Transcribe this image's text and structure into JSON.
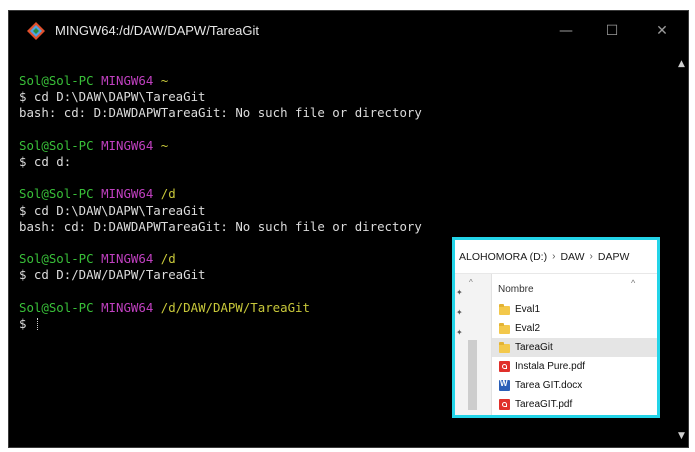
{
  "window": {
    "title": "MINGW64:/d/DAW/DAPW/TareaGit",
    "minimize_glyph": "—",
    "maximize_glyph": "☐",
    "close_glyph": "✕",
    "app_icon": "git-bash-icon"
  },
  "terminal": {
    "lines": [
      {
        "kind": "prompt",
        "user": "Sol@Sol-PC",
        "env": "MINGW64",
        "path": "~"
      },
      {
        "kind": "cmd",
        "text": "$ cd D:\\DAW\\DAPW\\TareaGit"
      },
      {
        "kind": "out",
        "text": "bash: cd: D:DAWDAPWTareaGit: No such file or directory"
      },
      {
        "kind": "blank"
      },
      {
        "kind": "prompt",
        "user": "Sol@Sol-PC",
        "env": "MINGW64",
        "path": "~"
      },
      {
        "kind": "cmd",
        "text": "$ cd d:"
      },
      {
        "kind": "blank"
      },
      {
        "kind": "prompt",
        "user": "Sol@Sol-PC",
        "env": "MINGW64",
        "path": "/d"
      },
      {
        "kind": "cmd",
        "text": "$ cd D:\\DAW\\DAPW\\TareaGit"
      },
      {
        "kind": "out",
        "text": "bash: cd: D:DAWDAPWTareaGit: No such file or directory"
      },
      {
        "kind": "blank"
      },
      {
        "kind": "prompt",
        "user": "Sol@Sol-PC",
        "env": "MINGW64",
        "path": "/d"
      },
      {
        "kind": "cmd",
        "text": "$ cd D:/DAW/DAPW/TareaGit"
      },
      {
        "kind": "blank"
      },
      {
        "kind": "prompt",
        "user": "Sol@Sol-PC",
        "env": "MINGW64",
        "path": "/d/DAW/DAPW/TareaGit"
      },
      {
        "kind": "input",
        "text": "$ "
      }
    ]
  },
  "explorer": {
    "breadcrumb": [
      "ALOHOMORA (D:)",
      "DAW",
      "DAPW"
    ],
    "breadcrumb_sep": "›",
    "column_header": "Nombre",
    "files": [
      {
        "name": "Eval1",
        "type": "folder",
        "selected": false
      },
      {
        "name": "Eval2",
        "type": "folder",
        "selected": false
      },
      {
        "name": "TareaGit",
        "type": "folder",
        "selected": true
      },
      {
        "name": "Instala Pure.pdf",
        "type": "pdf",
        "selected": false
      },
      {
        "name": "Tarea GIT.docx",
        "type": "docx",
        "selected": false
      },
      {
        "name": "TareaGIT.pdf",
        "type": "pdf",
        "selected": false
      }
    ]
  },
  "colors": {
    "user": "#39c039",
    "env": "#c040c0",
    "path": "#c8c83a",
    "text": "#dcdcdc",
    "highlight_border": "#23d4e8"
  }
}
